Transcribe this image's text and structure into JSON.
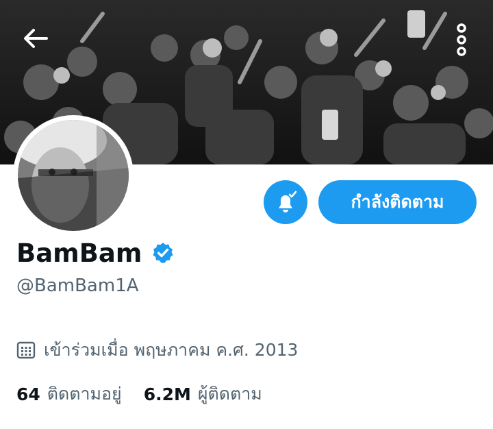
{
  "header": {
    "back_icon": "arrow-left-icon",
    "more_icon": "vertical-dots-icon"
  },
  "profile": {
    "display_name": "BamBam",
    "handle": "@BamBam1A",
    "verified": true,
    "joined_text": "เข้าร่วมเมื่อ พฤษภาคม ค.ศ. 2013",
    "joined_icon": "calendar-icon"
  },
  "actions": {
    "notify_icon": "bell-check-icon",
    "follow_label": "กำลังติดตาม"
  },
  "stats": {
    "following_count": "64",
    "following_label": "ติดตามอยู่",
    "followers_count": "6.2M",
    "followers_label": "ผู้ติดตาม"
  },
  "colors": {
    "accent": "#1d9bf0",
    "secondary_text": "#536471",
    "primary_text": "#0f1419"
  }
}
